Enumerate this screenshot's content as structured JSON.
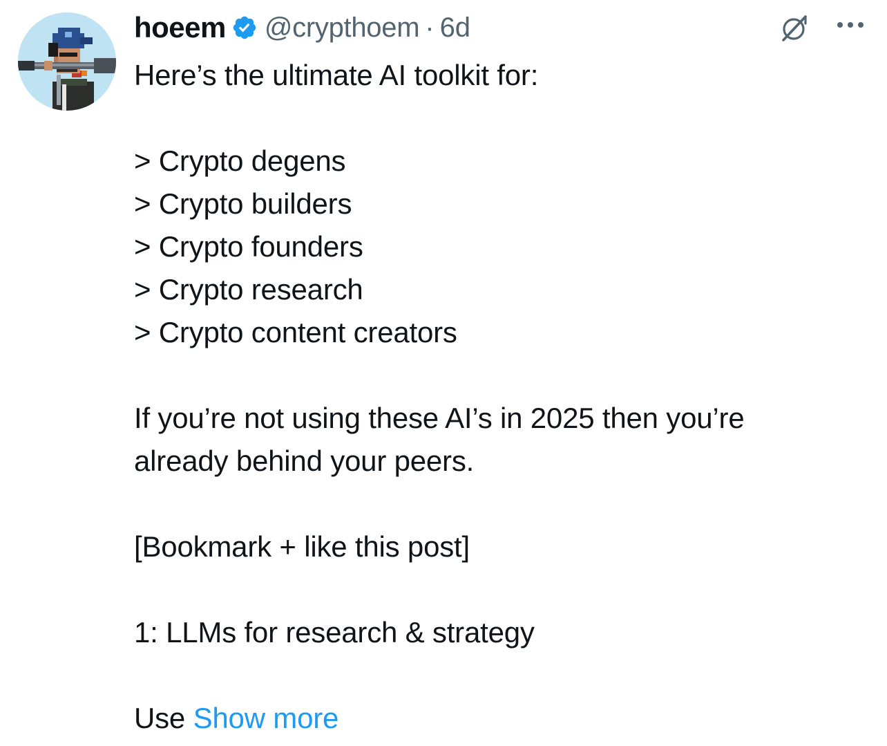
{
  "post": {
    "author": {
      "display_name": "hoeem",
      "handle": "@crypthoem",
      "verified": true,
      "avatar_icon": "pixel-art-avatar"
    },
    "separator": "·",
    "time": "6d",
    "actions": {
      "grok_icon": "grok-icon",
      "more_icon": "more-options-icon"
    },
    "text": {
      "intro": "Here’s the ultimate AI toolkit for:",
      "list": [
        "> Crypto degens",
        "> Crypto builders",
        "> Crypto founders",
        "> Crypto research",
        "> Crypto content creators"
      ],
      "para1_line1": "If you’re not using these AI’s in 2025 then you’re",
      "para1_line2": "already behind your peers.",
      "cta": "[Bookmark + like this post]",
      "section1": "1: LLMs for research & strategy",
      "truncated_start": "Use ",
      "show_more": "Show more"
    }
  },
  "colors": {
    "text_primary": "#0f1419",
    "text_secondary": "#536471",
    "link": "#1d9bf0",
    "verified": "#1d9bf0",
    "background": "#ffffff"
  }
}
